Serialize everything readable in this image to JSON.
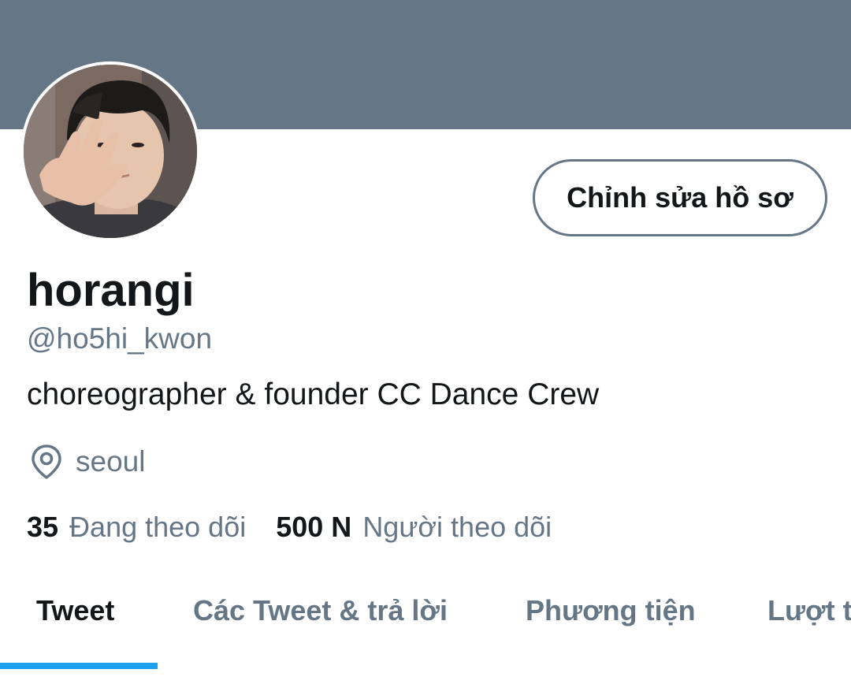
{
  "profile": {
    "display_name": "horangi",
    "handle": "@ho5hi_kwon",
    "bio": "choreographer & founder CC Dance Crew",
    "location": "seoul",
    "edit_button_label": "Chỉnh sửa hồ sơ",
    "avatar_icon": "profile-photo"
  },
  "stats": {
    "following_count": "35",
    "following_label": "Đang theo dõi",
    "followers_count": "500 N",
    "followers_label": "Người theo dõi"
  },
  "tabs": [
    {
      "label": "Tweet",
      "active": true
    },
    {
      "label": "Các Tweet & trả lời",
      "active": false
    },
    {
      "label": "Phương tiện",
      "active": false
    },
    {
      "label": "Lượt thích",
      "active": false
    }
  ],
  "colors": {
    "banner": "#657786",
    "accent": "#1da1f2",
    "text_primary": "#14171a",
    "text_secondary": "#657786"
  }
}
